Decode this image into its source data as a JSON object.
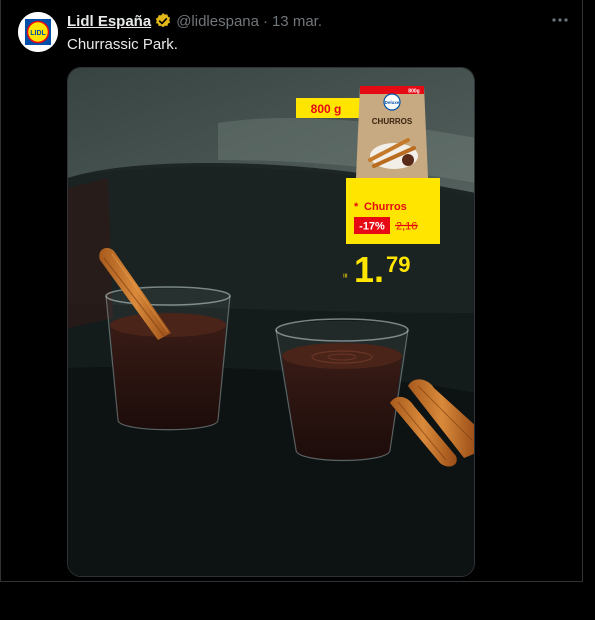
{
  "account": {
    "name": "Lidl España",
    "handle": "@lidlespana",
    "separator": "·",
    "date": "13 mar.",
    "logo_text": "LIDL"
  },
  "tweet": {
    "text": "Churrassic Park."
  },
  "promo": {
    "weight": "800 g",
    "package_brand": "Deluxe",
    "package_title": "CHURROS",
    "package_corner": "800g",
    "product_name": "Churros",
    "discount": "-17%",
    "old_price": "2,16",
    "price_int": "1",
    "price_dec": "79",
    "price_prefix": "≡",
    "asterisk": "*"
  },
  "colors": {
    "lidl_yellow": "#ffe500",
    "lidl_red": "#e60a14",
    "lidl_blue": "#0050aa",
    "verified_gold": "#e2b719"
  }
}
